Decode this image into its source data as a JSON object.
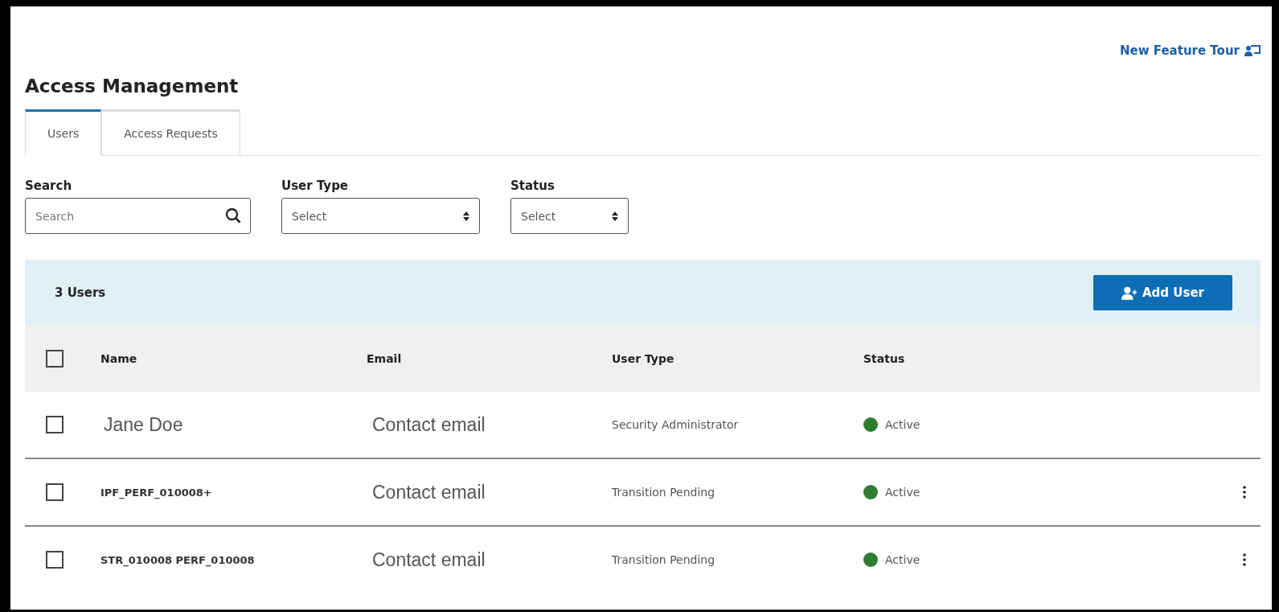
{
  "tour_link": {
    "label": "New Feature Tour"
  },
  "title": "Access Management",
  "tabs": [
    {
      "label": "Users",
      "selected": true
    },
    {
      "label": "Access Requests",
      "selected": false
    }
  ],
  "filters": [
    {
      "kind": "search",
      "label": "Search",
      "placeholder": "Search"
    },
    {
      "kind": "select",
      "label": "User Type",
      "placeholder": "Select"
    },
    {
      "kind": "select",
      "label": "Status",
      "placeholder": "Select"
    }
  ],
  "summary": {
    "count": "3 Users",
    "button": "Add User"
  },
  "table": {
    "select_all": {
      "checked": false
    },
    "columns": [
      "Name",
      "Email",
      "User Type",
      "Status"
    ],
    "rows": [
      {
        "checked": false,
        "name": "Jane Doe",
        "name_bold": false,
        "email": "Contact email",
        "user_type": "Security Administrator",
        "status": "Active",
        "color": "#2e7d32",
        "has_menu": false
      },
      {
        "checked": false,
        "name": "IPF_PERF_010008+",
        "name_bold": true,
        "email": "Contact email",
        "user_type": "Transition Pending",
        "status": "Active",
        "color": "#2e7d32",
        "has_menu": true
      },
      {
        "checked": false,
        "name": "STR_010008 PERF_010008",
        "name_bold": true,
        "email": "Contact email",
        "user_type": "Transition Pending",
        "status": "Active",
        "color": "#2e7d32",
        "has_menu": true
      }
    ]
  }
}
